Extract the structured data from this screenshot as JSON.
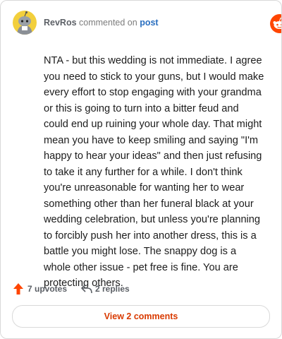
{
  "comment": {
    "author": "RevRos",
    "action_text": "commented on",
    "post_link": "post",
    "avatar_icon": "snoo-avatar-icon",
    "body": "NTA - but this wedding is not immediate. I agree you need to stick to your guns, but I would make every effort to stop engaging with your grandma or this is going to turn into a bitter feud and could end up ruining your whole day. That might mean you have to keep smiling and saying \"I'm happy to hear your ideas\" and then just refusing to take it any further for a while. I don't think you're unreasonable for wanting her to wear something other than her funeral black at your wedding celebration, but unless you're planning to forcibly push her into another dress, this is a battle you might lose. The snappy dog is a whole other issue - pet free is fine. You are protecting others."
  },
  "brand": {
    "name": "reddit",
    "icon": "reddit-logo-icon",
    "color": "#ff4500"
  },
  "actions": {
    "upvotes": "7 upvotes",
    "replies": "2 replies",
    "upvote_icon": "upvote-arrow-icon",
    "reply_icon": "reply-arrow-icon"
  },
  "view_button": "View 2 comments",
  "colors": {
    "accent": "#d93a00",
    "link": "#2a6fc0",
    "avatar_bg": "#f2cf3c"
  }
}
